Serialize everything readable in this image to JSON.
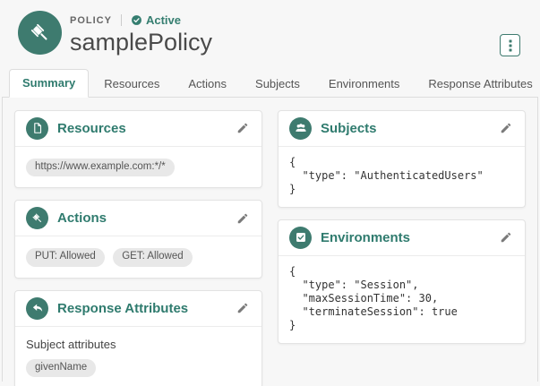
{
  "colors": {
    "primary_teal": "#3e7b6f",
    "title_teal": "#2f7b6e",
    "page_background": "#f7f7f7",
    "card_background": "#ffffff",
    "tag_background": "#e8e8e8"
  },
  "header": {
    "type_label": "POLICY",
    "status": "Active",
    "title": "samplePolicy"
  },
  "tabs": [
    {
      "label": "Summary",
      "active": true
    },
    {
      "label": "Resources",
      "active": false
    },
    {
      "label": "Actions",
      "active": false
    },
    {
      "label": "Subjects",
      "active": false
    },
    {
      "label": "Environments",
      "active": false
    },
    {
      "label": "Response Attributes",
      "active": false
    }
  ],
  "cards": {
    "resources": {
      "title": "Resources",
      "tags": [
        "https://www.example.com:*/*"
      ]
    },
    "actions": {
      "title": "Actions",
      "tags": [
        "PUT: Allowed",
        "GET: Allowed"
      ]
    },
    "response_attributes": {
      "title": "Response Attributes",
      "subtitle": "Subject attributes",
      "tags": [
        "givenName"
      ]
    },
    "subjects": {
      "title": "Subjects",
      "code": "{\n  \"type\": \"AuthenticatedUsers\"\n}"
    },
    "environments": {
      "title": "Environments",
      "code": "{\n  \"type\": \"Session\",\n  \"maxSessionTime\": 30,\n  \"terminateSession\": true\n}"
    }
  }
}
